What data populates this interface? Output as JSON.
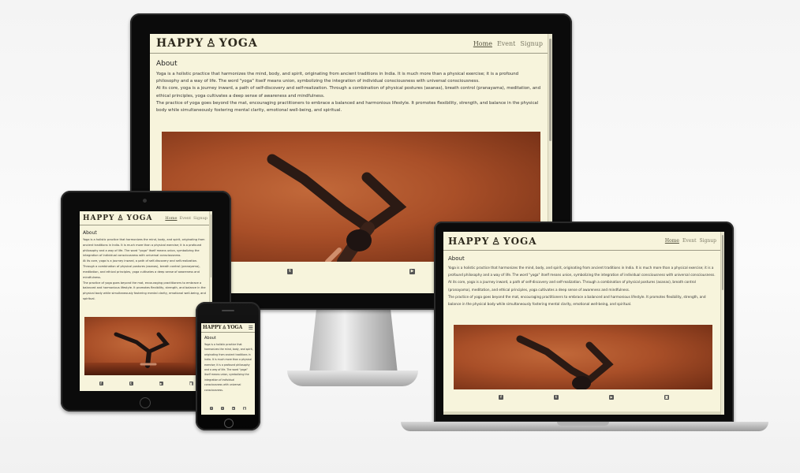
{
  "site": {
    "brand_left": "HAPPY",
    "brand_right": "YOGA",
    "brand_icon": "yoga-figure-icon",
    "nav": [
      {
        "label": "Home",
        "active": true
      },
      {
        "label": "Event",
        "active": false
      },
      {
        "label": "Signup",
        "active": false
      }
    ],
    "section_title": "About",
    "paragraphs": [
      "Yoga is a holistic practice that harmonizes the mind, body, and spirit, originating from ancient traditions in India. It is much more than a physical exercise; it is a profound philosophy and a way of life. The word \"yoga\" itself means union, symbolizing the integration of individual consciousness with universal consciousness.",
      "At its core, yoga is a journey inward, a path of self-discovery and self-realization. Through a combination of physical postures (asanas), breath control (pranayama), meditation, and ethical principles, yoga cultivates a deep sense of awareness and mindfulness.",
      "The practice of yoga goes beyond the mat, encouraging practitioners to embrace a balanced and harmonious lifestyle. It promotes flexibility, strength, and balance in the physical body while simultaneously fostering mental clarity, emotional well-being, and spiritual."
    ],
    "social_icons": [
      "facebook-icon",
      "twitter-icon",
      "youtube-icon",
      "instagram-icon"
    ],
    "social_glyphs": [
      "f",
      "t",
      "▶",
      "◙"
    ]
  },
  "colors": {
    "page_background": "#f7f4dc",
    "brand_text": "#2e2a1e",
    "nav_text": "#7c7a66",
    "photo_accent": "#b45a2e",
    "bezel": "#0b0b0b"
  }
}
